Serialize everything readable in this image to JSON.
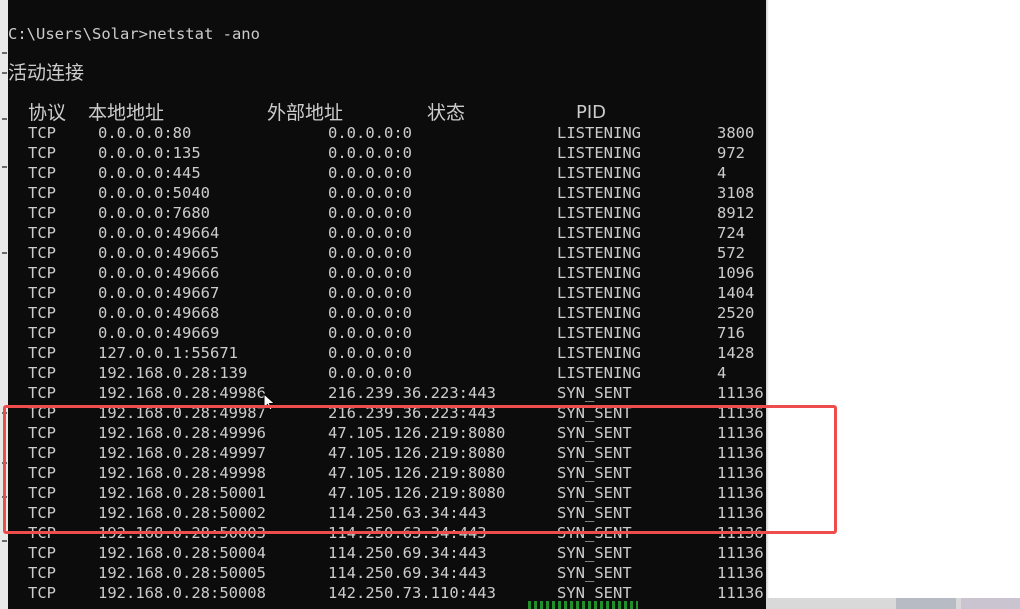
{
  "console": {
    "prompt": "C:\\Users\\Solar>netstat -ano",
    "section_title": "活动连接",
    "headers": {
      "proto": "协议",
      "local": "本地地址",
      "remote": "外部地址",
      "state": "状态",
      "pid": "PID"
    },
    "rows": [
      {
        "proto": "TCP",
        "local": "0.0.0.0:80",
        "remote": "0.0.0.0:0",
        "state": "LISTENING",
        "pid": "3800"
      },
      {
        "proto": "TCP",
        "local": "0.0.0.0:135",
        "remote": "0.0.0.0:0",
        "state": "LISTENING",
        "pid": "972"
      },
      {
        "proto": "TCP",
        "local": "0.0.0.0:445",
        "remote": "0.0.0.0:0",
        "state": "LISTENING",
        "pid": "4"
      },
      {
        "proto": "TCP",
        "local": "0.0.0.0:5040",
        "remote": "0.0.0.0:0",
        "state": "LISTENING",
        "pid": "3108"
      },
      {
        "proto": "TCP",
        "local": "0.0.0.0:7680",
        "remote": "0.0.0.0:0",
        "state": "LISTENING",
        "pid": "8912"
      },
      {
        "proto": "TCP",
        "local": "0.0.0.0:49664",
        "remote": "0.0.0.0:0",
        "state": "LISTENING",
        "pid": "724"
      },
      {
        "proto": "TCP",
        "local": "0.0.0.0:49665",
        "remote": "0.0.0.0:0",
        "state": "LISTENING",
        "pid": "572"
      },
      {
        "proto": "TCP",
        "local": "0.0.0.0:49666",
        "remote": "0.0.0.0:0",
        "state": "LISTENING",
        "pid": "1096"
      },
      {
        "proto": "TCP",
        "local": "0.0.0.0:49667",
        "remote": "0.0.0.0:0",
        "state": "LISTENING",
        "pid": "1404"
      },
      {
        "proto": "TCP",
        "local": "0.0.0.0:49668",
        "remote": "0.0.0.0:0",
        "state": "LISTENING",
        "pid": "2520"
      },
      {
        "proto": "TCP",
        "local": "0.0.0.0:49669",
        "remote": "0.0.0.0:0",
        "state": "LISTENING",
        "pid": "716"
      },
      {
        "proto": "TCP",
        "local": "127.0.0.1:55671",
        "remote": "0.0.0.0:0",
        "state": "LISTENING",
        "pid": "1428"
      },
      {
        "proto": "TCP",
        "local": "192.168.0.28:139",
        "remote": "0.0.0.0:0",
        "state": "LISTENING",
        "pid": "4"
      },
      {
        "proto": "TCP",
        "local": "192.168.0.28:49986",
        "remote": "216.239.36.223:443",
        "state": "SYN_SENT",
        "pid": "11136"
      },
      {
        "proto": "TCP",
        "local": "192.168.0.28:49987",
        "remote": "216.239.36.223:443",
        "state": "SYN_SENT",
        "pid": "11136"
      },
      {
        "proto": "TCP",
        "local": "192.168.0.28:49996",
        "remote": "47.105.126.219:8080",
        "state": "SYN_SENT",
        "pid": "11136"
      },
      {
        "proto": "TCP",
        "local": "192.168.0.28:49997",
        "remote": "47.105.126.219:8080",
        "state": "SYN_SENT",
        "pid": "11136"
      },
      {
        "proto": "TCP",
        "local": "192.168.0.28:49998",
        "remote": "47.105.126.219:8080",
        "state": "SYN_SENT",
        "pid": "11136"
      },
      {
        "proto": "TCP",
        "local": "192.168.0.28:50001",
        "remote": "47.105.126.219:8080",
        "state": "SYN_SENT",
        "pid": "11136"
      },
      {
        "proto": "TCP",
        "local": "192.168.0.28:50002",
        "remote": "114.250.63.34:443",
        "state": "SYN_SENT",
        "pid": "11136"
      },
      {
        "proto": "TCP",
        "local": "192.168.0.28:50003",
        "remote": "114.250.63.34:443",
        "state": "SYN_SENT",
        "pid": "11136"
      },
      {
        "proto": "TCP",
        "local": "192.168.0.28:50004",
        "remote": "114.250.69.34:443",
        "state": "SYN_SENT",
        "pid": "11136"
      },
      {
        "proto": "TCP",
        "local": "192.168.0.28:50005",
        "remote": "114.250.69.34:443",
        "state": "SYN_SENT",
        "pid": "11136"
      },
      {
        "proto": "TCP",
        "local": "192.168.0.28:50008",
        "remote": "142.250.73.110:443",
        "state": "SYN_SENT",
        "pid": "11136"
      }
    ]
  },
  "colors": {
    "console_bg": "#0c0c0c",
    "console_text": "#cccccc",
    "highlight_border": "#ee4d4d"
  },
  "annotation": {
    "kind": "red-rectangle-highlight"
  }
}
